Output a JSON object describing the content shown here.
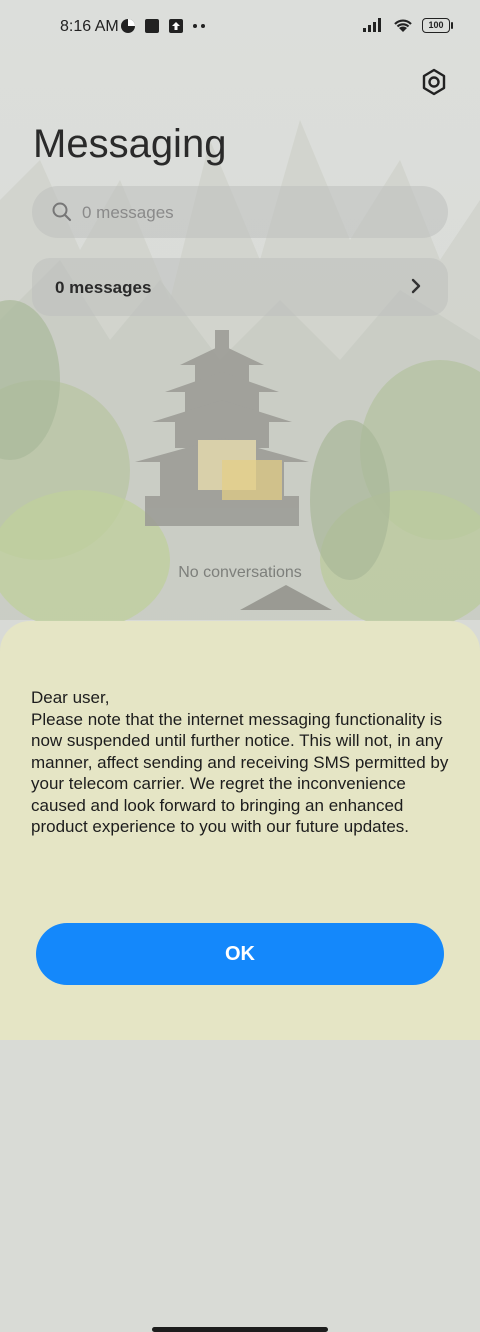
{
  "status_bar": {
    "time": "8:16 AM",
    "battery": "100",
    "icons_left": [
      "data-saver-icon",
      "app-notification-icon",
      "upload-icon",
      "more-dots-icon"
    ],
    "icons_right": [
      "signal-icon",
      "wifi-icon",
      "battery-icon"
    ]
  },
  "header": {
    "title": "Messaging",
    "settings_icon": "settings-icon"
  },
  "search": {
    "placeholder": "0 messages",
    "icon": "search-icon"
  },
  "messages_row": {
    "label": "0 messages",
    "icon": "chevron-right-icon"
  },
  "empty_state": {
    "text": "No conversations"
  },
  "dialog": {
    "body": "Dear user,\nPlease note that the internet messaging functionality is now suspended until further notice. This will not, in any manner, affect sending and receiving SMS permitted by your telecom carrier. We regret the inconvenience caused and look forward to bringing an enhanced product experience to you with our future updates.",
    "ok_label": "OK"
  },
  "colors": {
    "accent": "#1488fb",
    "sheet_background": "#e5e5c5",
    "title_text": "#2a2a2a"
  }
}
